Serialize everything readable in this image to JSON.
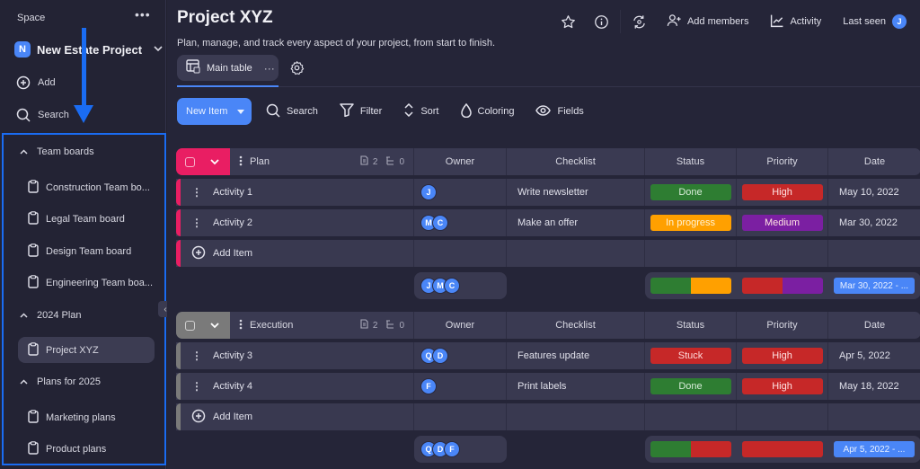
{
  "sidebar": {
    "space_label": "Space",
    "project": {
      "initial": "N",
      "name": "New Estate Project"
    },
    "add_label": "Add",
    "search_label": "Search",
    "groups": [
      {
        "label": "Team boards",
        "items": [
          "Construction Team bo...",
          "Legal Team board",
          "Design Team board",
          "Engineering Team boa..."
        ]
      },
      {
        "label": "2024 Plan",
        "items": [
          "Project XYZ"
        ]
      },
      {
        "label": "Plans for 2025",
        "items": [
          "Marketing plans",
          "Product plans"
        ]
      }
    ],
    "active_item": "Project XYZ"
  },
  "header": {
    "title": "Project XYZ",
    "subtitle": "Plan, manage, and track every aspect of your project, from start to finish.",
    "add_members": "Add members",
    "activity": "Activity",
    "last_seen": "Last seen",
    "user_initial": "J"
  },
  "tabs": {
    "main_table": "Main table"
  },
  "toolbar": {
    "new_item": "New Item",
    "search": "Search",
    "filter": "Filter",
    "sort": "Sort",
    "coloring": "Coloring",
    "fields": "Fields"
  },
  "columns": {
    "owner": "Owner",
    "checklist": "Checklist",
    "status": "Status",
    "priority": "Priority",
    "date": "Date"
  },
  "colors": {
    "accent": "#4a86f7",
    "plan_group": "#e91e63",
    "execution_group": "#7a7a7a",
    "done": "#2e7d32",
    "in_progress": "#ffa000",
    "stuck": "#c62828",
    "high": "#c62828",
    "medium": "#7b1fa2"
  },
  "groups": [
    {
      "name": "Plan",
      "color": "#e91e63",
      "doc_count": "2",
      "sub_count": "0",
      "rows": [
        {
          "name": "Activity 1",
          "owners": [
            "J"
          ],
          "checklist": "Write newsletter",
          "status": "Done",
          "status_color": "#2e7d32",
          "status_text": "#d7ecd8",
          "priority": "High",
          "priority_color": "#c62828",
          "date": "May 10, 2022"
        },
        {
          "name": "Activity 2",
          "owners": [
            "M",
            "C"
          ],
          "checklist": "Make an offer",
          "status": "In progress",
          "status_color": "#ffa000",
          "status_text": "#fff3d6",
          "priority": "Medium",
          "priority_color": "#7b1fa2",
          "date": "Mar 30, 2022"
        }
      ],
      "add_item": "Add Item",
      "summary": {
        "owners": [
          "J",
          "M",
          "C"
        ],
        "status_mix": [
          {
            "color": "#2e7d32",
            "share": 0.5
          },
          {
            "color": "#ffa000",
            "share": 0.5
          }
        ],
        "priority_mix": [
          {
            "color": "#c62828",
            "share": 0.5
          },
          {
            "color": "#7b1fa2",
            "share": 0.5
          }
        ],
        "date_range": "Mar 30, 2022 - ..."
      }
    },
    {
      "name": "Execution",
      "color": "#7a7a7a",
      "doc_count": "2",
      "sub_count": "0",
      "rows": [
        {
          "name": "Activity 3",
          "owners": [
            "Q",
            "D"
          ],
          "checklist": "Features update",
          "status": "Stuck",
          "status_color": "#c62828",
          "status_text": "#ffdada",
          "priority": "High",
          "priority_color": "#c62828",
          "date": "Apr 5, 2022"
        },
        {
          "name": "Activity 4",
          "owners": [
            "F"
          ],
          "checklist": "Print labels",
          "status": "Done",
          "status_color": "#2e7d32",
          "status_text": "#d7ecd8",
          "priority": "High",
          "priority_color": "#c62828",
          "date": "May 18, 2022"
        }
      ],
      "add_item": "Add Item",
      "summary": {
        "owners": [
          "Q",
          "D",
          "F"
        ],
        "status_mix": [
          {
            "color": "#2e7d32",
            "share": 0.5
          },
          {
            "color": "#c62828",
            "share": 0.5
          }
        ],
        "priority_mix": [
          {
            "color": "#c62828",
            "share": 1.0
          }
        ],
        "date_range": "Apr 5, 2022 - ..."
      }
    }
  ]
}
